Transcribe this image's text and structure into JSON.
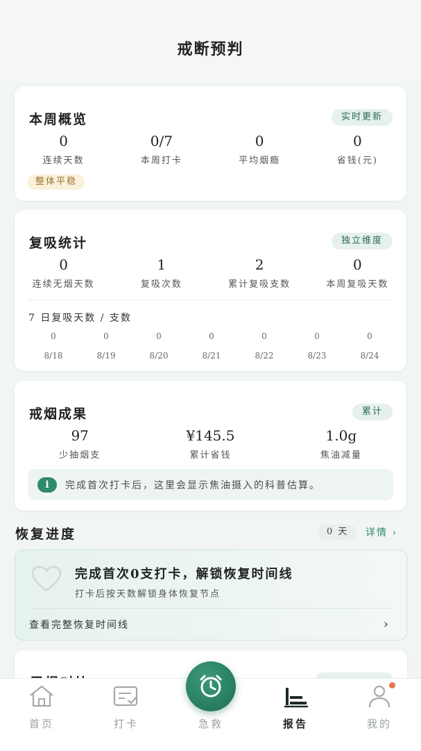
{
  "header": {
    "title": "戒断预判"
  },
  "weekly": {
    "title": "本周概览",
    "badge": "实时更新",
    "stats": [
      {
        "value": "0",
        "label": "连续天数"
      },
      {
        "value": "0/7",
        "label": "本周打卡"
      },
      {
        "value": "0",
        "label": "平均烟瘾"
      },
      {
        "value": "0",
        "label": "省钱(元)"
      }
    ],
    "status_chip": "整体平稳"
  },
  "relapse": {
    "title": "复吸统计",
    "badge": "独立维度",
    "stats": [
      {
        "value": "0",
        "label": "连续无烟天数"
      },
      {
        "value": "1",
        "label": "复吸次数"
      },
      {
        "value": "2",
        "label": "累计复吸支数"
      },
      {
        "value": "0",
        "label": "本周复吸天数"
      }
    ],
    "seven_day_title": "7 日复吸天数 / 支数",
    "seven_day": [
      {
        "value": "0",
        "date": "8/18"
      },
      {
        "value": "0",
        "date": "8/19"
      },
      {
        "value": "0",
        "date": "8/20"
      },
      {
        "value": "0",
        "date": "8/21"
      },
      {
        "value": "0",
        "date": "8/22"
      },
      {
        "value": "0",
        "date": "8/23"
      },
      {
        "value": "0",
        "date": "8/24"
      }
    ]
  },
  "results": {
    "title": "戒烟成果",
    "badge": "累计",
    "stats": [
      {
        "value": "97",
        "label": "少抽烟支"
      },
      {
        "value": "¥145.5",
        "label": "累计省钱"
      },
      {
        "value": "1.0g",
        "label": "焦油减量"
      }
    ],
    "info_icon": "i",
    "info": "完成首次打卡后，这里会显示焦油摄入的科普估算。"
  },
  "recovery": {
    "title": "恢复进度",
    "days": "0 天",
    "details": "详情 ›",
    "card_title": "完成首次0支打卡，解锁恢复时间线",
    "card_sub": "打卡后按天数解锁身体恢复节点",
    "link": "查看完整恢复时间线",
    "chevron": "›"
  },
  "peek": {
    "title": "周报对比"
  },
  "tabs": [
    {
      "label": "首页",
      "icon": "home-icon"
    },
    {
      "label": "打卡",
      "icon": "checkin-icon"
    },
    {
      "label": "急救",
      "icon": "alarm-clock-icon"
    },
    {
      "label": "报告",
      "icon": "bar-chart-icon"
    },
    {
      "label": "我的",
      "icon": "person-icon"
    }
  ],
  "colors": {
    "accent": "#2f8a6b",
    "fab": "#1e6e55",
    "badge_dot": "#e8734e"
  }
}
